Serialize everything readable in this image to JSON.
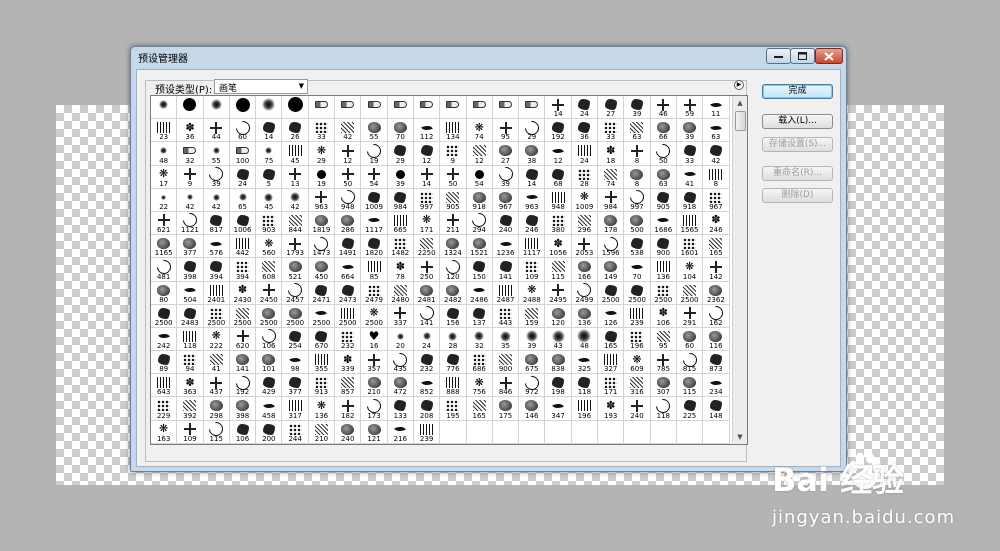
{
  "window": {
    "title": "预设管理器"
  },
  "preset": {
    "label": "预设类型(P):",
    "selected": "画笔"
  },
  "buttons": {
    "done": "完成",
    "load": "载入(L)...",
    "save": "存储设置(S)...",
    "rename": "重命名(R)...",
    "delete": "删除(D)"
  },
  "brush_rows": [
    [
      "",
      "",
      "",
      "",
      "",
      "",
      "",
      "",
      "",
      "",
      "",
      "",
      "",
      "",
      "",
      "14",
      "24",
      "27",
      "39",
      "46",
      "59",
      "11",
      "17"
    ],
    [
      "23",
      "36",
      "44",
      "60",
      "14",
      "26",
      "33",
      "42",
      "55",
      "70",
      "112",
      "134",
      "74",
      "95",
      "29",
      "192",
      "36",
      "33",
      "63",
      "66",
      "39",
      "63",
      "11"
    ],
    [
      "48",
      "32",
      "55",
      "100",
      "75",
      "45",
      "29",
      "12",
      "19",
      "29",
      "12",
      "9",
      "12",
      "27",
      "38",
      "12",
      "24",
      "18",
      "8",
      "50",
      "33",
      "42",
      "18"
    ],
    [
      "17",
      "9",
      "39",
      "24",
      "5",
      "13",
      "19",
      "50",
      "54",
      "39",
      "14",
      "50",
      "54",
      "39",
      "14",
      "68",
      "28",
      "74",
      "8",
      "63",
      "41",
      "8"
    ],
    [
      "22",
      "42",
      "42",
      "65",
      "45",
      "42",
      "963",
      "948",
      "1009",
      "984",
      "997",
      "905",
      "918",
      "967",
      "963",
      "948",
      "1009",
      "984",
      "997",
      "905",
      "918",
      "967"
    ],
    [
      "621",
      "1121",
      "817",
      "1006",
      "903",
      "844",
      "1819",
      "286",
      "1117",
      "665",
      "171",
      "211",
      "294",
      "240",
      "246",
      "380",
      "296",
      "178",
      "500",
      "1686",
      "1565",
      "246"
    ],
    [
      "1165",
      "377",
      "576",
      "442",
      "560",
      "1793",
      "1473",
      "1491",
      "1820",
      "1482",
      "2250",
      "1324",
      "1521",
      "1236",
      "1117",
      "1056",
      "2053",
      "1596",
      "538",
      "900",
      "1601",
      "165"
    ],
    [
      "481",
      "398",
      "394",
      "394",
      "608",
      "521",
      "450",
      "664",
      "85",
      "78",
      "250",
      "120",
      "150",
      "141",
      "109",
      "115",
      "166",
      "149",
      "70",
      "136",
      "104",
      "142"
    ],
    [
      "80",
      "504",
      "2401",
      "2430",
      "2450",
      "2457",
      "2471",
      "2473",
      "2479",
      "2480",
      "2481",
      "2482",
      "2486",
      "2487",
      "2488",
      "2495",
      "2499",
      "2500",
      "2500",
      "2500",
      "2500",
      "2362"
    ],
    [
      "2500",
      "2483",
      "2500",
      "2500",
      "2500",
      "2500",
      "2500",
      "2500",
      "2500",
      "337",
      "141",
      "156",
      "137",
      "443",
      "159",
      "120",
      "136",
      "126",
      "239",
      "106",
      "291",
      "162"
    ],
    [
      "242",
      "118",
      "222",
      "620",
      "106",
      "254",
      "670",
      "232",
      "16",
      "20",
      "24",
      "28",
      "32",
      "35",
      "39",
      "43",
      "48",
      "165",
      "196",
      "95",
      "60",
      "116"
    ],
    [
      "89",
      "94",
      "41",
      "141",
      "101",
      "98",
      "355",
      "339",
      "357",
      "435",
      "232",
      "776",
      "686",
      "900",
      "675",
      "838",
      "325",
      "327",
      "609",
      "785",
      "815",
      "873"
    ],
    [
      "643",
      "363",
      "437",
      "192",
      "429",
      "377",
      "913",
      "857",
      "210",
      "472",
      "852",
      "888",
      "756",
      "846",
      "972",
      "198",
      "118",
      "171",
      "316",
      "307",
      "115",
      "234"
    ],
    [
      "229",
      "392",
      "298",
      "398",
      "458",
      "317",
      "136",
      "182",
      "173",
      "133",
      "208",
      "195",
      "165",
      "175",
      "146",
      "347",
      "196",
      "193",
      "240",
      "118",
      "225",
      "148"
    ],
    [
      "163",
      "109",
      "115",
      "106",
      "200",
      "244",
      "210",
      "240",
      "121",
      "216",
      "239",
      "",
      "",
      "",
      "",
      "",
      "",
      "",
      "",
      "",
      "",
      ""
    ]
  ],
  "icons": {
    "scroll_up": "▲",
    "scroll_down": "▼",
    "flyout": "▶",
    "select_arrow": "▼",
    "minimize": "minimize-icon",
    "maximize": "maximize-icon",
    "close": "close-icon"
  },
  "watermark": {
    "logo": "Bai  经验",
    "url": "jingyan.baidu.com"
  }
}
